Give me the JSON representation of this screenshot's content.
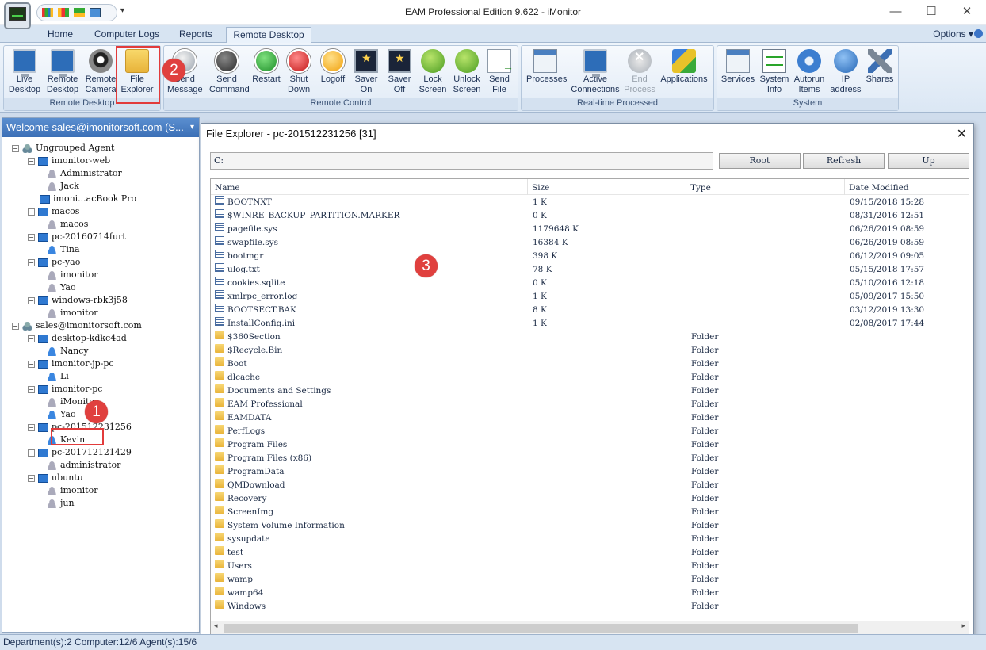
{
  "window": {
    "title": "EAM Professional Edition 9.622 - iMonitor",
    "minimize": "—",
    "maximize": "☐",
    "close": "✕"
  },
  "qat_dropdown": "▾",
  "tabs": [
    {
      "label": "Home"
    },
    {
      "label": "Computer Logs"
    },
    {
      "label": "Reports"
    },
    {
      "label": "Remote Desktop",
      "active": true
    }
  ],
  "options_label": "Options",
  "options_caret": "▾",
  "ribbon": {
    "groups": {
      "remote_desktop": "Remote Desktop",
      "remote_control": "Remote Control",
      "realtime": "Real-time Processed",
      "system": "System"
    },
    "buttons": {
      "live_desktop": "Live\nDesktop",
      "remote_desktop": "Remote\nDesktop",
      "remote_camera": "Remote\nCamera",
      "file_explorer": "File\nExplorer",
      "send_message": "Send\nMessage",
      "send_command": "Send\nCommand",
      "restart": "Restart",
      "shut_down": "Shut\nDown",
      "logoff": "Logoff",
      "saver_on": "Saver\nOn",
      "saver_off": "Saver\nOff",
      "lock_screen": "Lock\nScreen",
      "unlock_screen": "Unlock\nScreen",
      "send_file": "Send\nFile",
      "processes": "Processes",
      "active_connections": "Active\nConnections",
      "end_process": "End\nProcess",
      "applications": "Applications",
      "services": "Services",
      "system_info": "System\nInfo",
      "autorun_items": "Autorun\nItems",
      "ip_address": "IP\naddress",
      "shares": "Shares"
    }
  },
  "left_panel": {
    "header": "Welcome sales@imonitorsoft.com (S...",
    "header_caret": "▾",
    "tree": [
      {
        "label": "Ungrouped Agent",
        "level": 0,
        "icon": "group-icon",
        "exp": "−"
      },
      {
        "label": "imonitor-web",
        "level": 1,
        "icon": "computer-icon",
        "exp": "−"
      },
      {
        "label": "Administrator",
        "level": 2,
        "icon": "user-gray-icon"
      },
      {
        "label": "Jack",
        "level": 2,
        "icon": "user-gray-icon"
      },
      {
        "label": "imoni...acBook Pro",
        "level": 1,
        "icon": "computer-icon",
        "exp": ""
      },
      {
        "label": "macos",
        "level": 1,
        "icon": "computer-icon",
        "exp": "−"
      },
      {
        "label": "macos",
        "level": 2,
        "icon": "user-gray-icon"
      },
      {
        "label": "pc-20160714furt",
        "level": 1,
        "icon": "computer-icon",
        "exp": "−"
      },
      {
        "label": "Tina",
        "level": 2,
        "icon": "user-blue-icon"
      },
      {
        "label": "pc-yao",
        "level": 1,
        "icon": "computer-icon",
        "exp": "−"
      },
      {
        "label": "imonitor",
        "level": 2,
        "icon": "user-gray-icon"
      },
      {
        "label": "Yao",
        "level": 2,
        "icon": "user-gray-icon"
      },
      {
        "label": "windows-rbk3j58",
        "level": 1,
        "icon": "computer-icon",
        "exp": "−"
      },
      {
        "label": "imonitor",
        "level": 2,
        "icon": "user-gray-icon"
      },
      {
        "label": "sales@imonitorsoft.com",
        "level": 0,
        "icon": "group-icon",
        "exp": "−"
      },
      {
        "label": "desktop-kdkc4ad",
        "level": 1,
        "icon": "computer-icon",
        "exp": "−"
      },
      {
        "label": "Nancy",
        "level": 2,
        "icon": "user-blue-icon"
      },
      {
        "label": "imonitor-jp-pc",
        "level": 1,
        "icon": "computer-icon",
        "exp": "−"
      },
      {
        "label": "Li",
        "level": 2,
        "icon": "user-blue-icon"
      },
      {
        "label": "imonitor-pc",
        "level": 1,
        "icon": "computer-icon",
        "exp": "−"
      },
      {
        "label": "iMonitor",
        "level": 2,
        "icon": "user-gray-icon"
      },
      {
        "label": "Yao",
        "level": 2,
        "icon": "user-blue-icon"
      },
      {
        "label": "pc-201512231256",
        "level": 1,
        "icon": "computer-icon",
        "exp": "−"
      },
      {
        "label": "Kevin",
        "level": 2,
        "icon": "user-blue-icon",
        "selected": true
      },
      {
        "label": "pc-201712121429",
        "level": 1,
        "icon": "computer-icon",
        "exp": "−"
      },
      {
        "label": "administrator",
        "level": 2,
        "icon": "user-gray-icon"
      },
      {
        "label": "ubuntu",
        "level": 1,
        "icon": "computer-icon",
        "exp": "−"
      },
      {
        "label": "imonitor",
        "level": 2,
        "icon": "user-gray-icon"
      },
      {
        "label": "jun",
        "level": 2,
        "icon": "user-gray-icon"
      }
    ]
  },
  "file_explorer": {
    "title": "File Explorer - pc-201512231256 [31]",
    "close": "✕",
    "path": "C:",
    "buttons": {
      "root": "Root",
      "refresh": "Refresh",
      "up": "Up"
    },
    "columns": {
      "name": "Name",
      "size": "Size",
      "type": "Type",
      "date": "Date Modified"
    },
    "rows": [
      {
        "name": "BOOTNXT",
        "size": "1 K",
        "type": "",
        "date": "09/15/2018 15:28",
        "kind": "file"
      },
      {
        "name": "$WINRE_BACKUP_PARTITION.MARKER",
        "size": "0 K",
        "type": "",
        "date": "08/31/2016 12:51",
        "kind": "file"
      },
      {
        "name": "pagefile.sys",
        "size": "1179648 K",
        "type": "",
        "date": "06/26/2019 08:59",
        "kind": "file"
      },
      {
        "name": "swapfile.sys",
        "size": "16384 K",
        "type": "",
        "date": "06/26/2019 08:59",
        "kind": "file"
      },
      {
        "name": "bootmgr",
        "size": "398 K",
        "type": "",
        "date": "06/12/2019 09:05",
        "kind": "file"
      },
      {
        "name": "ulog.txt",
        "size": "78 K",
        "type": "",
        "date": "05/15/2018 17:57",
        "kind": "file"
      },
      {
        "name": "cookies.sqlite",
        "size": "0 K",
        "type": "",
        "date": "05/10/2016 12:18",
        "kind": "file"
      },
      {
        "name": "xmlrpc_error.log",
        "size": "1 K",
        "type": "",
        "date": "05/09/2017 15:50",
        "kind": "file"
      },
      {
        "name": "BOOTSECT.BAK",
        "size": "8 K",
        "type": "",
        "date": "03/12/2019 13:30",
        "kind": "file"
      },
      {
        "name": "InstallConfig.ini",
        "size": "1 K",
        "type": "",
        "date": "02/08/2017 17:44",
        "kind": "file"
      },
      {
        "name": "$360Section",
        "size": "",
        "type": "Folder",
        "date": "",
        "kind": "folder"
      },
      {
        "name": "$Recycle.Bin",
        "size": "",
        "type": "Folder",
        "date": "",
        "kind": "folder"
      },
      {
        "name": "Boot",
        "size": "",
        "type": "Folder",
        "date": "",
        "kind": "folder"
      },
      {
        "name": "dlcache",
        "size": "",
        "type": "Folder",
        "date": "",
        "kind": "folder"
      },
      {
        "name": "Documents and Settings",
        "size": "",
        "type": "Folder",
        "date": "",
        "kind": "folder"
      },
      {
        "name": "EAM Professional",
        "size": "",
        "type": "Folder",
        "date": "",
        "kind": "folder"
      },
      {
        "name": "EAMDATA",
        "size": "",
        "type": "Folder",
        "date": "",
        "kind": "folder"
      },
      {
        "name": "PerfLogs",
        "size": "",
        "type": "Folder",
        "date": "",
        "kind": "folder"
      },
      {
        "name": "Program Files",
        "size": "",
        "type": "Folder",
        "date": "",
        "kind": "folder"
      },
      {
        "name": "Program Files (x86)",
        "size": "",
        "type": "Folder",
        "date": "",
        "kind": "folder"
      },
      {
        "name": "ProgramData",
        "size": "",
        "type": "Folder",
        "date": "",
        "kind": "folder"
      },
      {
        "name": "QMDownload",
        "size": "",
        "type": "Folder",
        "date": "",
        "kind": "folder"
      },
      {
        "name": "Recovery",
        "size": "",
        "type": "Folder",
        "date": "",
        "kind": "folder"
      },
      {
        "name": "ScreenImg",
        "size": "",
        "type": "Folder",
        "date": "",
        "kind": "folder"
      },
      {
        "name": "System Volume Information",
        "size": "",
        "type": "Folder",
        "date": "",
        "kind": "folder"
      },
      {
        "name": "sysupdate",
        "size": "",
        "type": "Folder",
        "date": "",
        "kind": "folder"
      },
      {
        "name": "test",
        "size": "",
        "type": "Folder",
        "date": "",
        "kind": "folder"
      },
      {
        "name": "Users",
        "size": "",
        "type": "Folder",
        "date": "",
        "kind": "folder"
      },
      {
        "name": "wamp",
        "size": "",
        "type": "Folder",
        "date": "",
        "kind": "folder"
      },
      {
        "name": "wamp64",
        "size": "",
        "type": "Folder",
        "date": "",
        "kind": "folder"
      },
      {
        "name": "Windows",
        "size": "",
        "type": "Folder",
        "date": "",
        "kind": "folder"
      }
    ],
    "scroll_left": "◂",
    "scroll_right": "▸"
  },
  "status_bar": "Department(s):2  Computer:12/6  Agent(s):15/6",
  "callouts": [
    "1",
    "2",
    "3"
  ],
  "colors": {
    "accent": "#3b6fb6",
    "callout": "#e0403e",
    "highlight_box": "#e23b3b"
  }
}
